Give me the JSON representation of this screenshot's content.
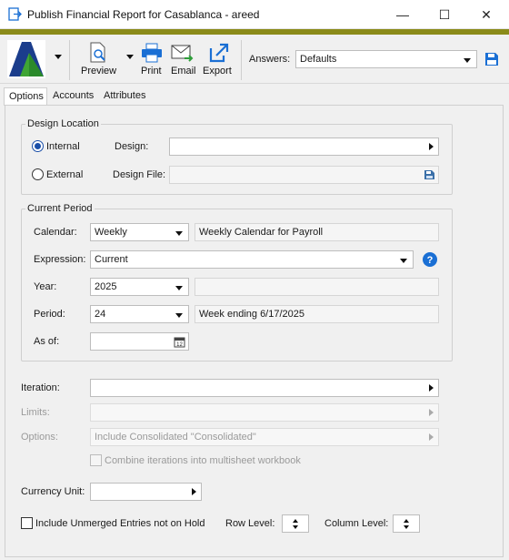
{
  "window": {
    "title": "Publish Financial Report for Casablanca - areed",
    "minimize": "—",
    "maximize": "☐",
    "close": "✕"
  },
  "toolbar": {
    "preview": "Preview",
    "print": "Print",
    "email": "Email",
    "export": "Export",
    "answers_label": "Answers:",
    "answers_value": "Defaults"
  },
  "tabs": [
    "Options",
    "Accounts",
    "Attributes"
  ],
  "design_location": {
    "group_label": "Design Location",
    "internal": "Internal",
    "external": "External",
    "design_label": "Design:",
    "design_value": "",
    "design_file_label": "Design File:",
    "design_file_value": ""
  },
  "current_period": {
    "group_label": "Current Period",
    "calendar_label": "Calendar:",
    "calendar_value": "Weekly",
    "calendar_desc": "Weekly Calendar for Payroll",
    "expression_label": "Expression:",
    "expression_value": "Current",
    "year_label": "Year:",
    "year_value": "2025",
    "year_desc": "",
    "period_label": "Period:",
    "period_value": "24",
    "period_desc": "Week ending 6/17/2025",
    "asof_label": "As of:",
    "asof_value": ""
  },
  "iteration": {
    "iteration_label": "Iteration:",
    "iteration_value": "",
    "limits_label": "Limits:",
    "limits_value": "",
    "options_label": "Options:",
    "options_value": "Include Consolidated \"Consolidated\"",
    "combine_label": "Combine iterations into multisheet workbook"
  },
  "currency": {
    "label": "Currency Unit:",
    "value": ""
  },
  "bottom": {
    "include_label": "Include Unmerged Entries not on Hold",
    "row_level_label": "Row Level:",
    "column_level_label": "Column Level:"
  },
  "colors": {
    "accent_bar": "#8b8b1a",
    "radio_selected": "#1a4fa8",
    "help_icon": "#1a6fd4"
  }
}
